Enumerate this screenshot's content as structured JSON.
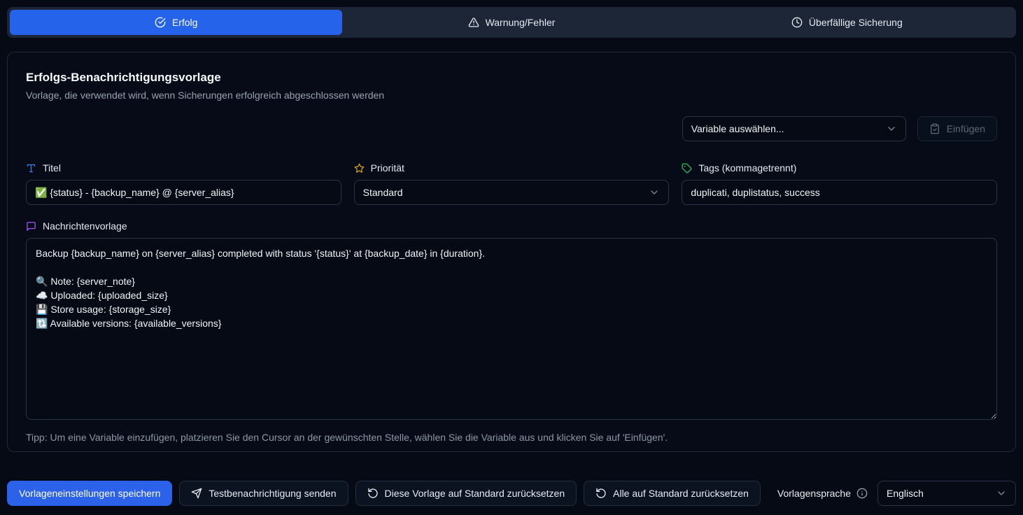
{
  "colors": {
    "accent": "#2563eb",
    "title_icon": "#3b82f6",
    "priority_icon": "#d9a514",
    "tags_icon": "#22c55e",
    "message_icon": "#a855f7"
  },
  "tabs": [
    {
      "label": "Erfolg",
      "icon": "check-circle-icon",
      "active": true
    },
    {
      "label": "Warnung/Fehler",
      "icon": "alert-triangle-icon",
      "active": false
    },
    {
      "label": "Überfällige Sicherung",
      "icon": "clock-icon",
      "active": false
    }
  ],
  "card": {
    "title": "Erfolgs-Benachrichtigungsvorlage",
    "subtitle": "Vorlage, die verwendet wird, wenn Sicherungen erfolgreich abgeschlossen werden",
    "variable_select": {
      "value": "Variable auswählen..."
    },
    "insert_button": {
      "label": "Einfügen",
      "disabled": true
    },
    "fields": {
      "title": {
        "label": "Titel",
        "value": "✅ {status} - {backup_name} @ {server_alias}"
      },
      "priority": {
        "label": "Priorität",
        "value": "Standard"
      },
      "tags": {
        "label": "Tags (kommagetrennt)",
        "value": "duplicati, duplistatus, success"
      },
      "message": {
        "label": "Nachrichtenvorlage",
        "value": "Backup {backup_name} on {server_alias} completed with status '{status}' at {backup_date} in {duration}.\n\n🔍 Note: {server_note}\n☁️ Uploaded: {uploaded_size}\n💾 Store usage: {storage_size}\n🔃 Available versions: {available_versions}"
      }
    },
    "tip": "Tipp: Um eine Variable einzufügen, platzieren Sie den Cursor an der gewünschten Stelle, wählen Sie die Variable aus und klicken Sie auf 'Einfügen'."
  },
  "footer": {
    "save_button": "Vorlageneinstellungen speichern",
    "test_button": "Testbenachrichtigung senden",
    "reset_this_button": "Diese Vorlage auf Standard zurücksetzen",
    "reset_all_button": "Alle auf Standard zurücksetzen",
    "language_label": "Vorlagensprache",
    "language_value": "Englisch"
  }
}
